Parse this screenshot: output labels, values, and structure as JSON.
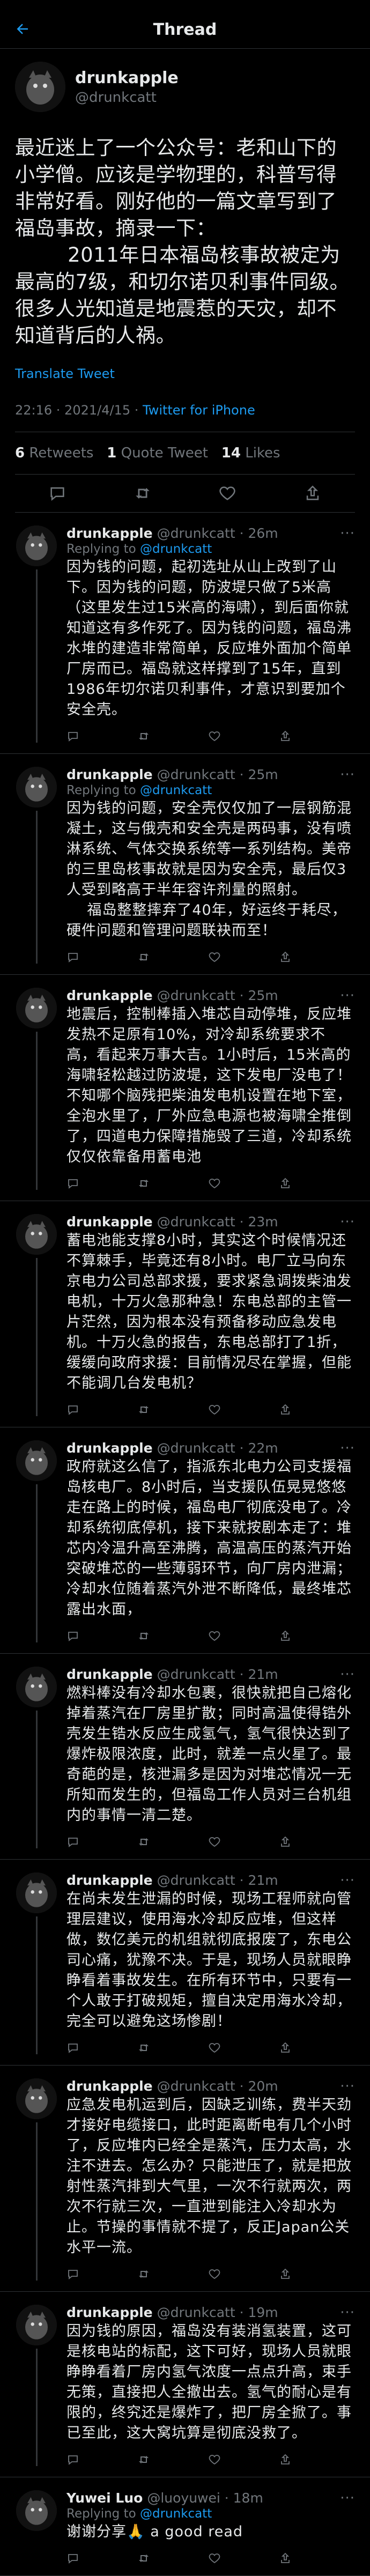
{
  "status_bar": {
    "time": "",
    "signal": ""
  },
  "nav": {
    "title": "Thread"
  },
  "main": {
    "display_name": "drunkapple",
    "handle": "@drunkcatt",
    "text": "最近迷上了一个公众号：老和山下的小学僧。应该是学物理的，科普写得非常好看。刚好他的一篇文章写到了福岛事故，摘录一下：\n        2011年日本福岛核事故被定为最高的7级，和切尔诺贝利事件同级。很多人光知道是地震惹的天灾，却不知道背后的人祸。",
    "translate": "Translate Tweet",
    "timestamp": "22:16 · 2021/4/15 · ",
    "client": "Twitter for iPhone",
    "stats": {
      "retweets_count": "6",
      "retweets_label": "Retweets",
      "quotes_count": "1",
      "quotes_label": "Quote Tweet",
      "likes_count": "14",
      "likes_label": "Likes"
    }
  },
  "replies": [
    {
      "display_name": "drunkapple",
      "handle": "@drunkcatt · 26m",
      "replying_prefix": "Replying to ",
      "replying_to": "@drunkcatt",
      "text": "因为钱的问题，起初选址从山上改到了山下。因为钱的问题，防波堤只做了5米高（这里发生过15米高的海啸），到后面你就知道这有多作死了。因为钱的问题，福岛沸水堆的建造非常简单，反应堆外面加个简单厂房而已。福岛就这样撑到了15年，直到1986年切尔诺贝利事件，才意识到要加个安全壳。"
    },
    {
      "display_name": "drunkapple",
      "handle": "@drunkcatt · 25m",
      "replying_prefix": "Replying to ",
      "replying_to": "@drunkcatt",
      "text": "因为钱的问题，安全壳仅仅加了一层钢筋混凝土，这与俄壳和安全壳是两码事，没有喷淋系统、气体交换系统等一系列结构。美帝的三里岛核事故就是因为安全壳，最后仅3人受到略高于半年容许剂量的照射。\n    福岛整整摔弃了40年，好运终于耗尽，硬件问题和管理问题联袂而至！"
    },
    {
      "display_name": "drunkapple",
      "handle": "@drunkcatt · 25m",
      "replying_prefix": "",
      "replying_to": "",
      "text": "地震后，控制棒插入堆芯自动停堆，反应堆发热不足原有10%，对冷却系统要求不高，看起来万事大吉。1小时后，15米高的海啸轻松越过防波堤，这下发电厂没电了！不知哪个脑残把柴油发电机设置在地下室，全泡水里了，厂外应急电源也被海啸全推倒了，四道电力保障措施毁了三道，冷却系统仅仅依靠备用蓄电池"
    },
    {
      "display_name": "drunkapple",
      "handle": "@drunkcatt · 23m",
      "replying_prefix": "",
      "replying_to": "",
      "text": "蓄电池能支撑8小时，其实这个时候情况还不算棘手，毕竟还有8小时。电厂立马向东京电力公司总部求援，要求紧急调拨柴油发电机，十万火急那种急！东电总部的主管一片茫然，因为根本没有预备移动应急发电机。十万火急的报告，东电总部打了1折，缓缓向政府求援：目前情况尽在掌握，但能不能调几台发电机？"
    },
    {
      "display_name": "drunkapple",
      "handle": "@drunkcatt · 22m",
      "replying_prefix": "",
      "replying_to": "",
      "text": "政府就这么信了，指派东北电力公司支援福岛核电厂。8小时后，当支援队伍晃晃悠悠走在路上的时候，福岛电厂彻底没电了。冷却系统彻底停机，接下来就按剧本走了：堆芯内冷温升高至沸腾，高温高压的蒸汽开始突破堆芯的一些薄弱环节，向厂房内泄漏；冷却水位随着蒸汽外泄不断降低，最终堆芯露出水面，"
    },
    {
      "display_name": "drunkapple",
      "handle": "@drunkcatt · 21m",
      "replying_prefix": "",
      "replying_to": "",
      "text": "燃料棒没有冷却水包裹，很快就把自己熔化掉着蒸汽在厂房里扩散；同时高温使得锆外壳发生锆水反应生成氢气，氢气很快达到了爆炸极限浓度，此时，就差一点火星了。最奇葩的是，核泄漏多是因为对堆芯情况一无所知而发生的，但福岛工作人员对三台机组内的事情一清二楚。"
    },
    {
      "display_name": "drunkapple",
      "handle": "@drunkcatt · 21m",
      "replying_prefix": "",
      "replying_to": "",
      "text": "在尚未发生泄漏的时候，现场工程师就向管理层建议，使用海水冷却反应堆，但这样做，数亿美元的机组就彻底报废了，东电公司心痛，犹豫不决。于是，现场人员就眼睁睁看着事故发生。在所有环节中，只要有一个人敢于打破规矩，擅自决定用海水冷却，完全可以避免这场惨剧！"
    },
    {
      "display_name": "drunkapple",
      "handle": "@drunkcatt · 20m",
      "replying_prefix": "",
      "replying_to": "",
      "text": "应急发电机运到后，因缺乏训练，费半天劲才接好电缆接口，此时距离断电有几个小时了，反应堆内已经全是蒸汽，压力太高，水注不进去。怎么办？只能泄压了，就是把放射性蒸汽排到大气里，一次不行就两次，两次不行就三次，一直泄到能注入冷却水为止。节操的事情就不提了，反正Japan公关水平一流。"
    },
    {
      "display_name": "drunkapple",
      "handle": "@drunkcatt · 19m",
      "replying_prefix": "",
      "replying_to": "",
      "text": "因为钱的原因，福岛没有装消氢装置，这可是核电站的标配，这下可好，现场人员就眼睁睁看着厂房内氢气浓度一点点升高，束手无策，直接把人全撤出去。氢气的耐心是有限的，终究还是爆炸了，把厂房全掀了。事已至此，这大窝坑算是彻底没救了。"
    },
    {
      "display_name": "Yuwei Luo",
      "handle": "@luoyuwei · 18m",
      "replying_prefix": "Replying to ",
      "replying_to": "@drunkcatt",
      "text": "谢谢分享🙏 a good read"
    }
  ],
  "icons": [
    "back-arrow-icon",
    "reply-icon",
    "retweet-icon",
    "like-icon",
    "share-icon",
    "more-icon"
  ]
}
